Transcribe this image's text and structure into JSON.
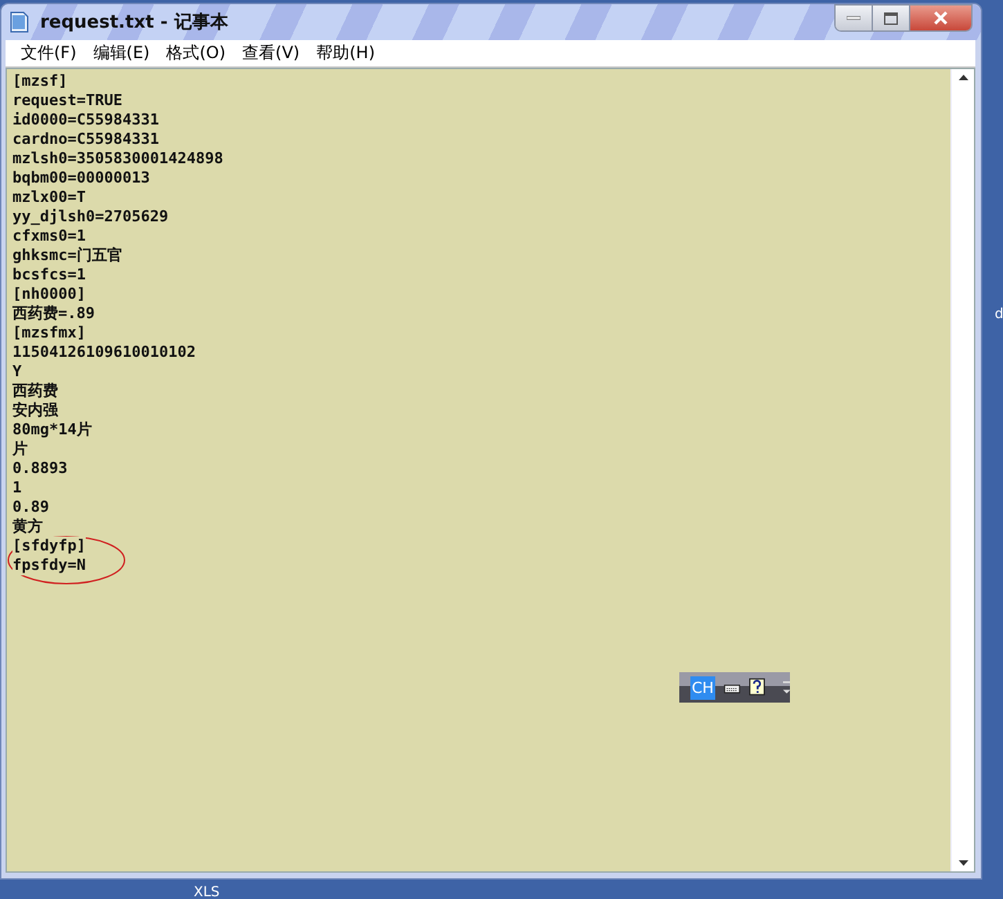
{
  "window": {
    "title": "request.txt - 记事本"
  },
  "menu": [
    "文件(F)",
    "编辑(E)",
    "格式(O)",
    "查看(V)",
    "帮助(H)"
  ],
  "document": {
    "lines": [
      "[mzsf]",
      "request=TRUE",
      "id0000=C55984331",
      "cardno=C55984331",
      "mzlsh0=3505830001424898",
      "bqbm00=00000013",
      "mzlx00=T",
      "yy_djlsh0=2705629",
      "cfxms0=1",
      "ghksmc=门五官",
      "bcsfcs=1",
      "[nh0000]",
      "西药费=.89",
      "[mzsfmx]",
      "11504126109610010102",
      "Y",
      "西药费",
      "安内强",
      "80mg*14片",
      "片",
      "0.8893",
      "1",
      "0.89",
      "黄方",
      "[sfdyfp]",
      "fpsfdy=N"
    ]
  },
  "language_bar": {
    "indicator": "CH"
  },
  "desktop": {
    "labels": [
      "XLS",
      "d"
    ]
  }
}
